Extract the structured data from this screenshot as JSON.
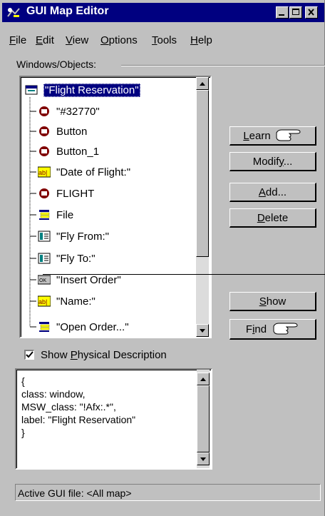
{
  "window": {
    "title": "GUI Map Editor"
  },
  "menu": [
    {
      "label": "File",
      "accel": "F",
      "rest": "ile"
    },
    {
      "label": "Edit",
      "accel": "E",
      "rest": "dit"
    },
    {
      "label": "View",
      "accel": "V",
      "rest": "iew"
    },
    {
      "label": "Options",
      "accel": "O",
      "rest": "ptions"
    },
    {
      "label": "Tools",
      "accel": "T",
      "rest": "ools"
    },
    {
      "label": "Help",
      "accel": "H",
      "rest": "elp"
    }
  ],
  "group_label": "Windows/Objects:",
  "tree": {
    "root": "\"Flight Reservation\"",
    "items": [
      {
        "label": "\"#32770\"",
        "icon": "dialog-icon"
      },
      {
        "label": "Button",
        "icon": "dialog-icon"
      },
      {
        "label": "Button_1",
        "icon": "dialog-icon"
      },
      {
        "label": "\"Date of Flight:\"",
        "icon": "edit-field-icon"
      },
      {
        "label": "FLIGHT",
        "icon": "dialog-icon"
      },
      {
        "label": "File",
        "icon": "menu-icon"
      },
      {
        "label": "\"Fly From:\"",
        "icon": "list-icon"
      },
      {
        "label": "\"Fly To:\"",
        "icon": "list-icon"
      },
      {
        "label": "\"Insert Order\"",
        "icon": "push-button-icon"
      },
      {
        "label": "\"Name:\"",
        "icon": "edit-field-icon"
      },
      {
        "label": "\"Open Order...\"",
        "icon": "menu-icon"
      }
    ]
  },
  "buttons": {
    "learn": {
      "accel": "L",
      "rest": "earn"
    },
    "modify": {
      "pre": "Modif",
      "accel": "y",
      "rest": "..."
    },
    "add": {
      "accel": "A",
      "rest": "dd..."
    },
    "delete": {
      "accel": "D",
      "rest": "elete"
    },
    "show": {
      "accel": "S",
      "rest": "how"
    },
    "find": {
      "pre": "F",
      "accel": "i",
      "rest": "nd"
    }
  },
  "show_physical": {
    "checked": true,
    "pre": "Show ",
    "accel": "P",
    "rest": "hysical Description"
  },
  "description": [
    "{",
    "class: window,",
    "MSW_class: \"!Afx:.*\",",
    "label: \"Flight Reservation\"",
    "}"
  ],
  "status": "Active GUI file: <All map>"
}
